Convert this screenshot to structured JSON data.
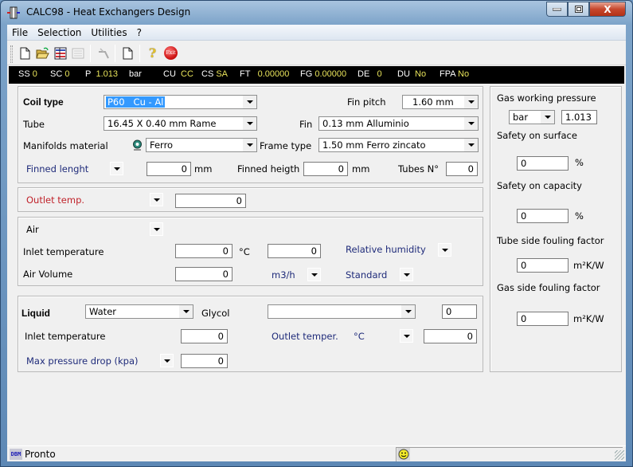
{
  "window": {
    "title": "CALC98 - Heat Exchangers Design",
    "close_glyph": "X"
  },
  "menu": [
    "File",
    "Selection",
    "Utilities",
    "?"
  ],
  "toolbar": {
    "buttons": [
      "new-icon",
      "open-folder-icon",
      "database-icon",
      "list-icon-disabled",
      "tool-icon-disabled",
      "page-icon",
      "help-icon",
      "exit-icon"
    ],
    "exit_label": "Exit",
    "help_glyph": "?"
  },
  "status_strip": [
    {
      "key": "SS",
      "value": "0"
    },
    {
      "key": "SC",
      "value": "0"
    },
    {
      "key": "P",
      "value": "1.013"
    },
    {
      "key": "bar",
      "value": ""
    },
    {
      "key": "CU",
      "value": "CC"
    },
    {
      "key": "CS",
      "value": "SA"
    },
    {
      "key": "FT",
      "value": "0.00000"
    },
    {
      "key": "FG",
      "value": "0.00000"
    },
    {
      "key": "DE",
      "value": "0"
    },
    {
      "key": "DU",
      "value": "No"
    },
    {
      "key": "FPA",
      "value": "No"
    }
  ],
  "coil": {
    "coil_type_label": "Coil type",
    "coil_type_value": "P60   Cu - Al",
    "fin_pitch_label": "Fin pitch",
    "fin_pitch_value": "1.60 mm",
    "tube_label": "Tube",
    "tube_value": "16.45 X 0.40 mm Rame",
    "fin_label": "Fin",
    "fin_value": "0.13 mm Alluminio",
    "manifolds_label": "Manifolds material",
    "manifolds_value": "Ferro",
    "frame_label": "Frame type",
    "frame_value": "1.50 mm Ferro zincato",
    "finned_length_label": "Finned lenght",
    "finned_length_value": "0",
    "finned_length_unit": "mm",
    "finned_height_label": "Finned heigth",
    "finned_height_value": "0",
    "finned_height_unit": "mm",
    "tubes_label": "Tubes N°",
    "tubes_value": "0"
  },
  "outlet": {
    "label": "Outlet temp.",
    "value": "0"
  },
  "air": {
    "gas_label": "Air",
    "inlet_label": "Inlet temperature",
    "inlet_value": "0",
    "inlet_unit": "°C",
    "humidity_value": "0",
    "humidity_label": "Relative humidity",
    "volume_label": "Air Volume",
    "volume_value": "0",
    "volume_unit": "m3/h",
    "standard_label": "Standard"
  },
  "liquid": {
    "label": "Liquid",
    "fluid_value": "Water",
    "glycol_label": "Glycol",
    "glycol_value": "",
    "glycol_percent": "0",
    "inlet_label": "Inlet temperature",
    "inlet_value": "0",
    "outlet_label": "Outlet temper.",
    "outlet_unit": "°C",
    "outlet_value": "0",
    "pressure_drop_label": "Max pressure drop  (kpa)",
    "pressure_drop_value": "0"
  },
  "side": {
    "gas_pressure_label": "Gas working pressure",
    "pressure_unit": "bar",
    "pressure_value": "1.013",
    "safety_surface_label": "Safety on surface",
    "safety_surface_value": "0",
    "safety_surface_unit": "%",
    "safety_capacity_label": "Safety on capacity",
    "safety_capacity_value": "0",
    "safety_capacity_unit": "%",
    "tube_fouling_label": "Tube side fouling factor",
    "tube_fouling_value": "0",
    "tube_fouling_unit": "m²K/W",
    "gas_fouling_label": "Gas side fouling factor",
    "gas_fouling_value": "0",
    "gas_fouling_unit": "m²K/W"
  },
  "statusbar": {
    "icon_text": "DBM",
    "text": "Pronto"
  }
}
